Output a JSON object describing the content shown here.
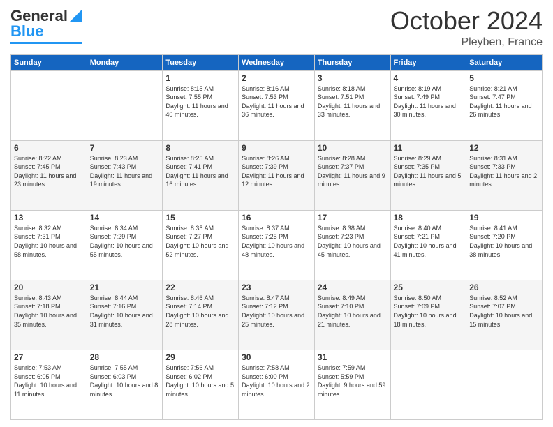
{
  "header": {
    "logo_line1": "General",
    "logo_line2": "Blue",
    "month_title": "October 2024",
    "location": "Pleyben, France"
  },
  "days_of_week": [
    "Sunday",
    "Monday",
    "Tuesday",
    "Wednesday",
    "Thursday",
    "Friday",
    "Saturday"
  ],
  "weeks": [
    [
      {
        "day": "",
        "sunrise": "",
        "sunset": "",
        "daylight": ""
      },
      {
        "day": "",
        "sunrise": "",
        "sunset": "",
        "daylight": ""
      },
      {
        "day": "1",
        "sunrise": "Sunrise: 8:15 AM",
        "sunset": "Sunset: 7:55 PM",
        "daylight": "Daylight: 11 hours and 40 minutes."
      },
      {
        "day": "2",
        "sunrise": "Sunrise: 8:16 AM",
        "sunset": "Sunset: 7:53 PM",
        "daylight": "Daylight: 11 hours and 36 minutes."
      },
      {
        "day": "3",
        "sunrise": "Sunrise: 8:18 AM",
        "sunset": "Sunset: 7:51 PM",
        "daylight": "Daylight: 11 hours and 33 minutes."
      },
      {
        "day": "4",
        "sunrise": "Sunrise: 8:19 AM",
        "sunset": "Sunset: 7:49 PM",
        "daylight": "Daylight: 11 hours and 30 minutes."
      },
      {
        "day": "5",
        "sunrise": "Sunrise: 8:21 AM",
        "sunset": "Sunset: 7:47 PM",
        "daylight": "Daylight: 11 hours and 26 minutes."
      }
    ],
    [
      {
        "day": "6",
        "sunrise": "Sunrise: 8:22 AM",
        "sunset": "Sunset: 7:45 PM",
        "daylight": "Daylight: 11 hours and 23 minutes."
      },
      {
        "day": "7",
        "sunrise": "Sunrise: 8:23 AM",
        "sunset": "Sunset: 7:43 PM",
        "daylight": "Daylight: 11 hours and 19 minutes."
      },
      {
        "day": "8",
        "sunrise": "Sunrise: 8:25 AM",
        "sunset": "Sunset: 7:41 PM",
        "daylight": "Daylight: 11 hours and 16 minutes."
      },
      {
        "day": "9",
        "sunrise": "Sunrise: 8:26 AM",
        "sunset": "Sunset: 7:39 PM",
        "daylight": "Daylight: 11 hours and 12 minutes."
      },
      {
        "day": "10",
        "sunrise": "Sunrise: 8:28 AM",
        "sunset": "Sunset: 7:37 PM",
        "daylight": "Daylight: 11 hours and 9 minutes."
      },
      {
        "day": "11",
        "sunrise": "Sunrise: 8:29 AM",
        "sunset": "Sunset: 7:35 PM",
        "daylight": "Daylight: 11 hours and 5 minutes."
      },
      {
        "day": "12",
        "sunrise": "Sunrise: 8:31 AM",
        "sunset": "Sunset: 7:33 PM",
        "daylight": "Daylight: 11 hours and 2 minutes."
      }
    ],
    [
      {
        "day": "13",
        "sunrise": "Sunrise: 8:32 AM",
        "sunset": "Sunset: 7:31 PM",
        "daylight": "Daylight: 10 hours and 58 minutes."
      },
      {
        "day": "14",
        "sunrise": "Sunrise: 8:34 AM",
        "sunset": "Sunset: 7:29 PM",
        "daylight": "Daylight: 10 hours and 55 minutes."
      },
      {
        "day": "15",
        "sunrise": "Sunrise: 8:35 AM",
        "sunset": "Sunset: 7:27 PM",
        "daylight": "Daylight: 10 hours and 52 minutes."
      },
      {
        "day": "16",
        "sunrise": "Sunrise: 8:37 AM",
        "sunset": "Sunset: 7:25 PM",
        "daylight": "Daylight: 10 hours and 48 minutes."
      },
      {
        "day": "17",
        "sunrise": "Sunrise: 8:38 AM",
        "sunset": "Sunset: 7:23 PM",
        "daylight": "Daylight: 10 hours and 45 minutes."
      },
      {
        "day": "18",
        "sunrise": "Sunrise: 8:40 AM",
        "sunset": "Sunset: 7:21 PM",
        "daylight": "Daylight: 10 hours and 41 minutes."
      },
      {
        "day": "19",
        "sunrise": "Sunrise: 8:41 AM",
        "sunset": "Sunset: 7:20 PM",
        "daylight": "Daylight: 10 hours and 38 minutes."
      }
    ],
    [
      {
        "day": "20",
        "sunrise": "Sunrise: 8:43 AM",
        "sunset": "Sunset: 7:18 PM",
        "daylight": "Daylight: 10 hours and 35 minutes."
      },
      {
        "day": "21",
        "sunrise": "Sunrise: 8:44 AM",
        "sunset": "Sunset: 7:16 PM",
        "daylight": "Daylight: 10 hours and 31 minutes."
      },
      {
        "day": "22",
        "sunrise": "Sunrise: 8:46 AM",
        "sunset": "Sunset: 7:14 PM",
        "daylight": "Daylight: 10 hours and 28 minutes."
      },
      {
        "day": "23",
        "sunrise": "Sunrise: 8:47 AM",
        "sunset": "Sunset: 7:12 PM",
        "daylight": "Daylight: 10 hours and 25 minutes."
      },
      {
        "day": "24",
        "sunrise": "Sunrise: 8:49 AM",
        "sunset": "Sunset: 7:10 PM",
        "daylight": "Daylight: 10 hours and 21 minutes."
      },
      {
        "day": "25",
        "sunrise": "Sunrise: 8:50 AM",
        "sunset": "Sunset: 7:09 PM",
        "daylight": "Daylight: 10 hours and 18 minutes."
      },
      {
        "day": "26",
        "sunrise": "Sunrise: 8:52 AM",
        "sunset": "Sunset: 7:07 PM",
        "daylight": "Daylight: 10 hours and 15 minutes."
      }
    ],
    [
      {
        "day": "27",
        "sunrise": "Sunrise: 7:53 AM",
        "sunset": "Sunset: 6:05 PM",
        "daylight": "Daylight: 10 hours and 11 minutes."
      },
      {
        "day": "28",
        "sunrise": "Sunrise: 7:55 AM",
        "sunset": "Sunset: 6:03 PM",
        "daylight": "Daylight: 10 hours and 8 minutes."
      },
      {
        "day": "29",
        "sunrise": "Sunrise: 7:56 AM",
        "sunset": "Sunset: 6:02 PM",
        "daylight": "Daylight: 10 hours and 5 minutes."
      },
      {
        "day": "30",
        "sunrise": "Sunrise: 7:58 AM",
        "sunset": "Sunset: 6:00 PM",
        "daylight": "Daylight: 10 hours and 2 minutes."
      },
      {
        "day": "31",
        "sunrise": "Sunrise: 7:59 AM",
        "sunset": "Sunset: 5:59 PM",
        "daylight": "Daylight: 9 hours and 59 minutes."
      },
      {
        "day": "",
        "sunrise": "",
        "sunset": "",
        "daylight": ""
      },
      {
        "day": "",
        "sunrise": "",
        "sunset": "",
        "daylight": ""
      }
    ]
  ]
}
